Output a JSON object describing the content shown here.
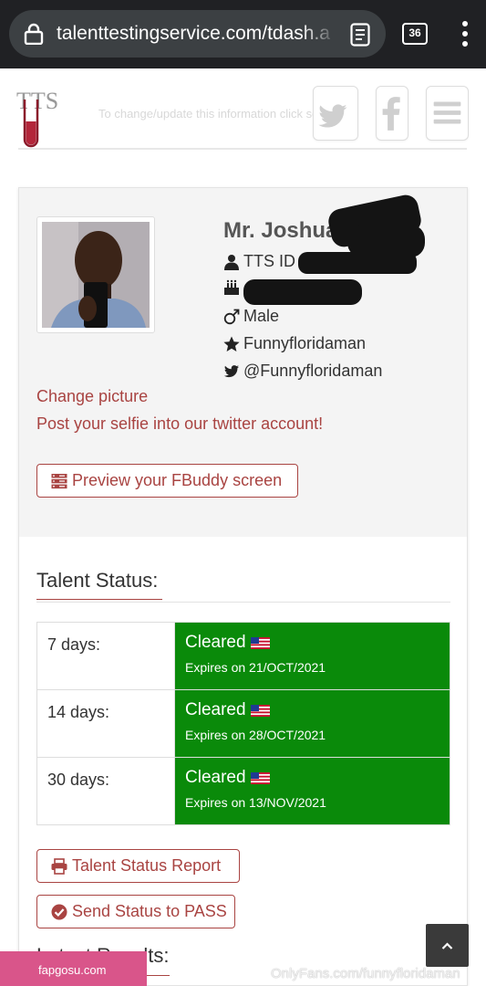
{
  "browser": {
    "url": "talenttestingservice.com/tdash.a",
    "tab_count": "36"
  },
  "header": {
    "logo_text": "TTS",
    "notice": "To change/update this information click settings"
  },
  "profile": {
    "name": "Mr. Joshua",
    "tts_id_label": "TTS ID #",
    "gender": "Male",
    "username": "Funnyfloridaman",
    "twitter": "@Funnyfloridaman",
    "change_picture": "Change picture",
    "selfie_prompt": "Post your selfie into our twitter account!",
    "preview_button": "Preview your FBuddy screen"
  },
  "talent_status": {
    "title": "Talent Status:",
    "rows": [
      {
        "period": "7 days:",
        "status": "Cleared",
        "expires": "Expires on 21/OCT/2021"
      },
      {
        "period": "14 days:",
        "status": "Cleared",
        "expires": "Expires on 28/OCT/2021"
      },
      {
        "period": "30 days:",
        "status": "Cleared",
        "expires": "Expires on 13/NOV/2021"
      }
    ],
    "report_button": "Talent Status Report",
    "pass_button": "Send Status to PASS"
  },
  "latest_results": {
    "title": "Latest Results:"
  },
  "watermarks": {
    "left": "fapgosu.com",
    "right": "OnlyFans.com/funnyfloridaman"
  },
  "colors": {
    "accent": "#a94442",
    "cleared": "#0a8a0a",
    "browser_bar": "#202124"
  }
}
